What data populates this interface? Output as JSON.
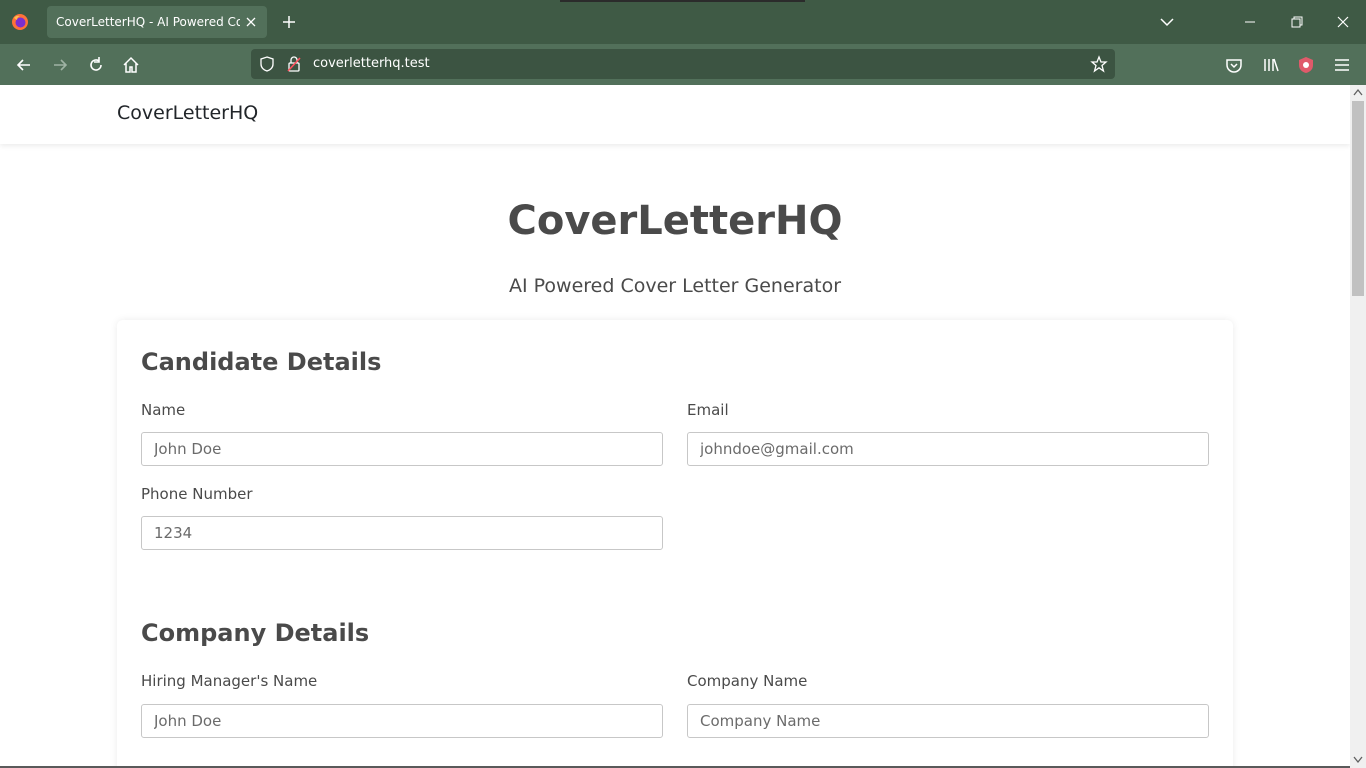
{
  "browser": {
    "tab_title": "CoverLetterHQ - AI Powered Cover Letter Generator",
    "url": "coverletterhq.test"
  },
  "site": {
    "brand": "CoverLetterHQ"
  },
  "hero": {
    "title": "CoverLetterHQ",
    "subtitle": "AI Powered Cover Letter Generator"
  },
  "candidate": {
    "heading": "Candidate Details",
    "name_label": "Name",
    "name_placeholder": "John Doe",
    "email_label": "Email",
    "email_placeholder": "johndoe@gmail.com",
    "phone_label": "Phone Number",
    "phone_placeholder": "1234"
  },
  "company": {
    "heading": "Company Details",
    "manager_label": "Hiring Manager's Name",
    "manager_placeholder": "John Doe",
    "company_label": "Company Name",
    "company_placeholder": "Company Name"
  },
  "colors": {
    "chrome_tabbar": "#3f5a45",
    "chrome_toolbar": "#52705a",
    "text": "#4a4a4a"
  }
}
